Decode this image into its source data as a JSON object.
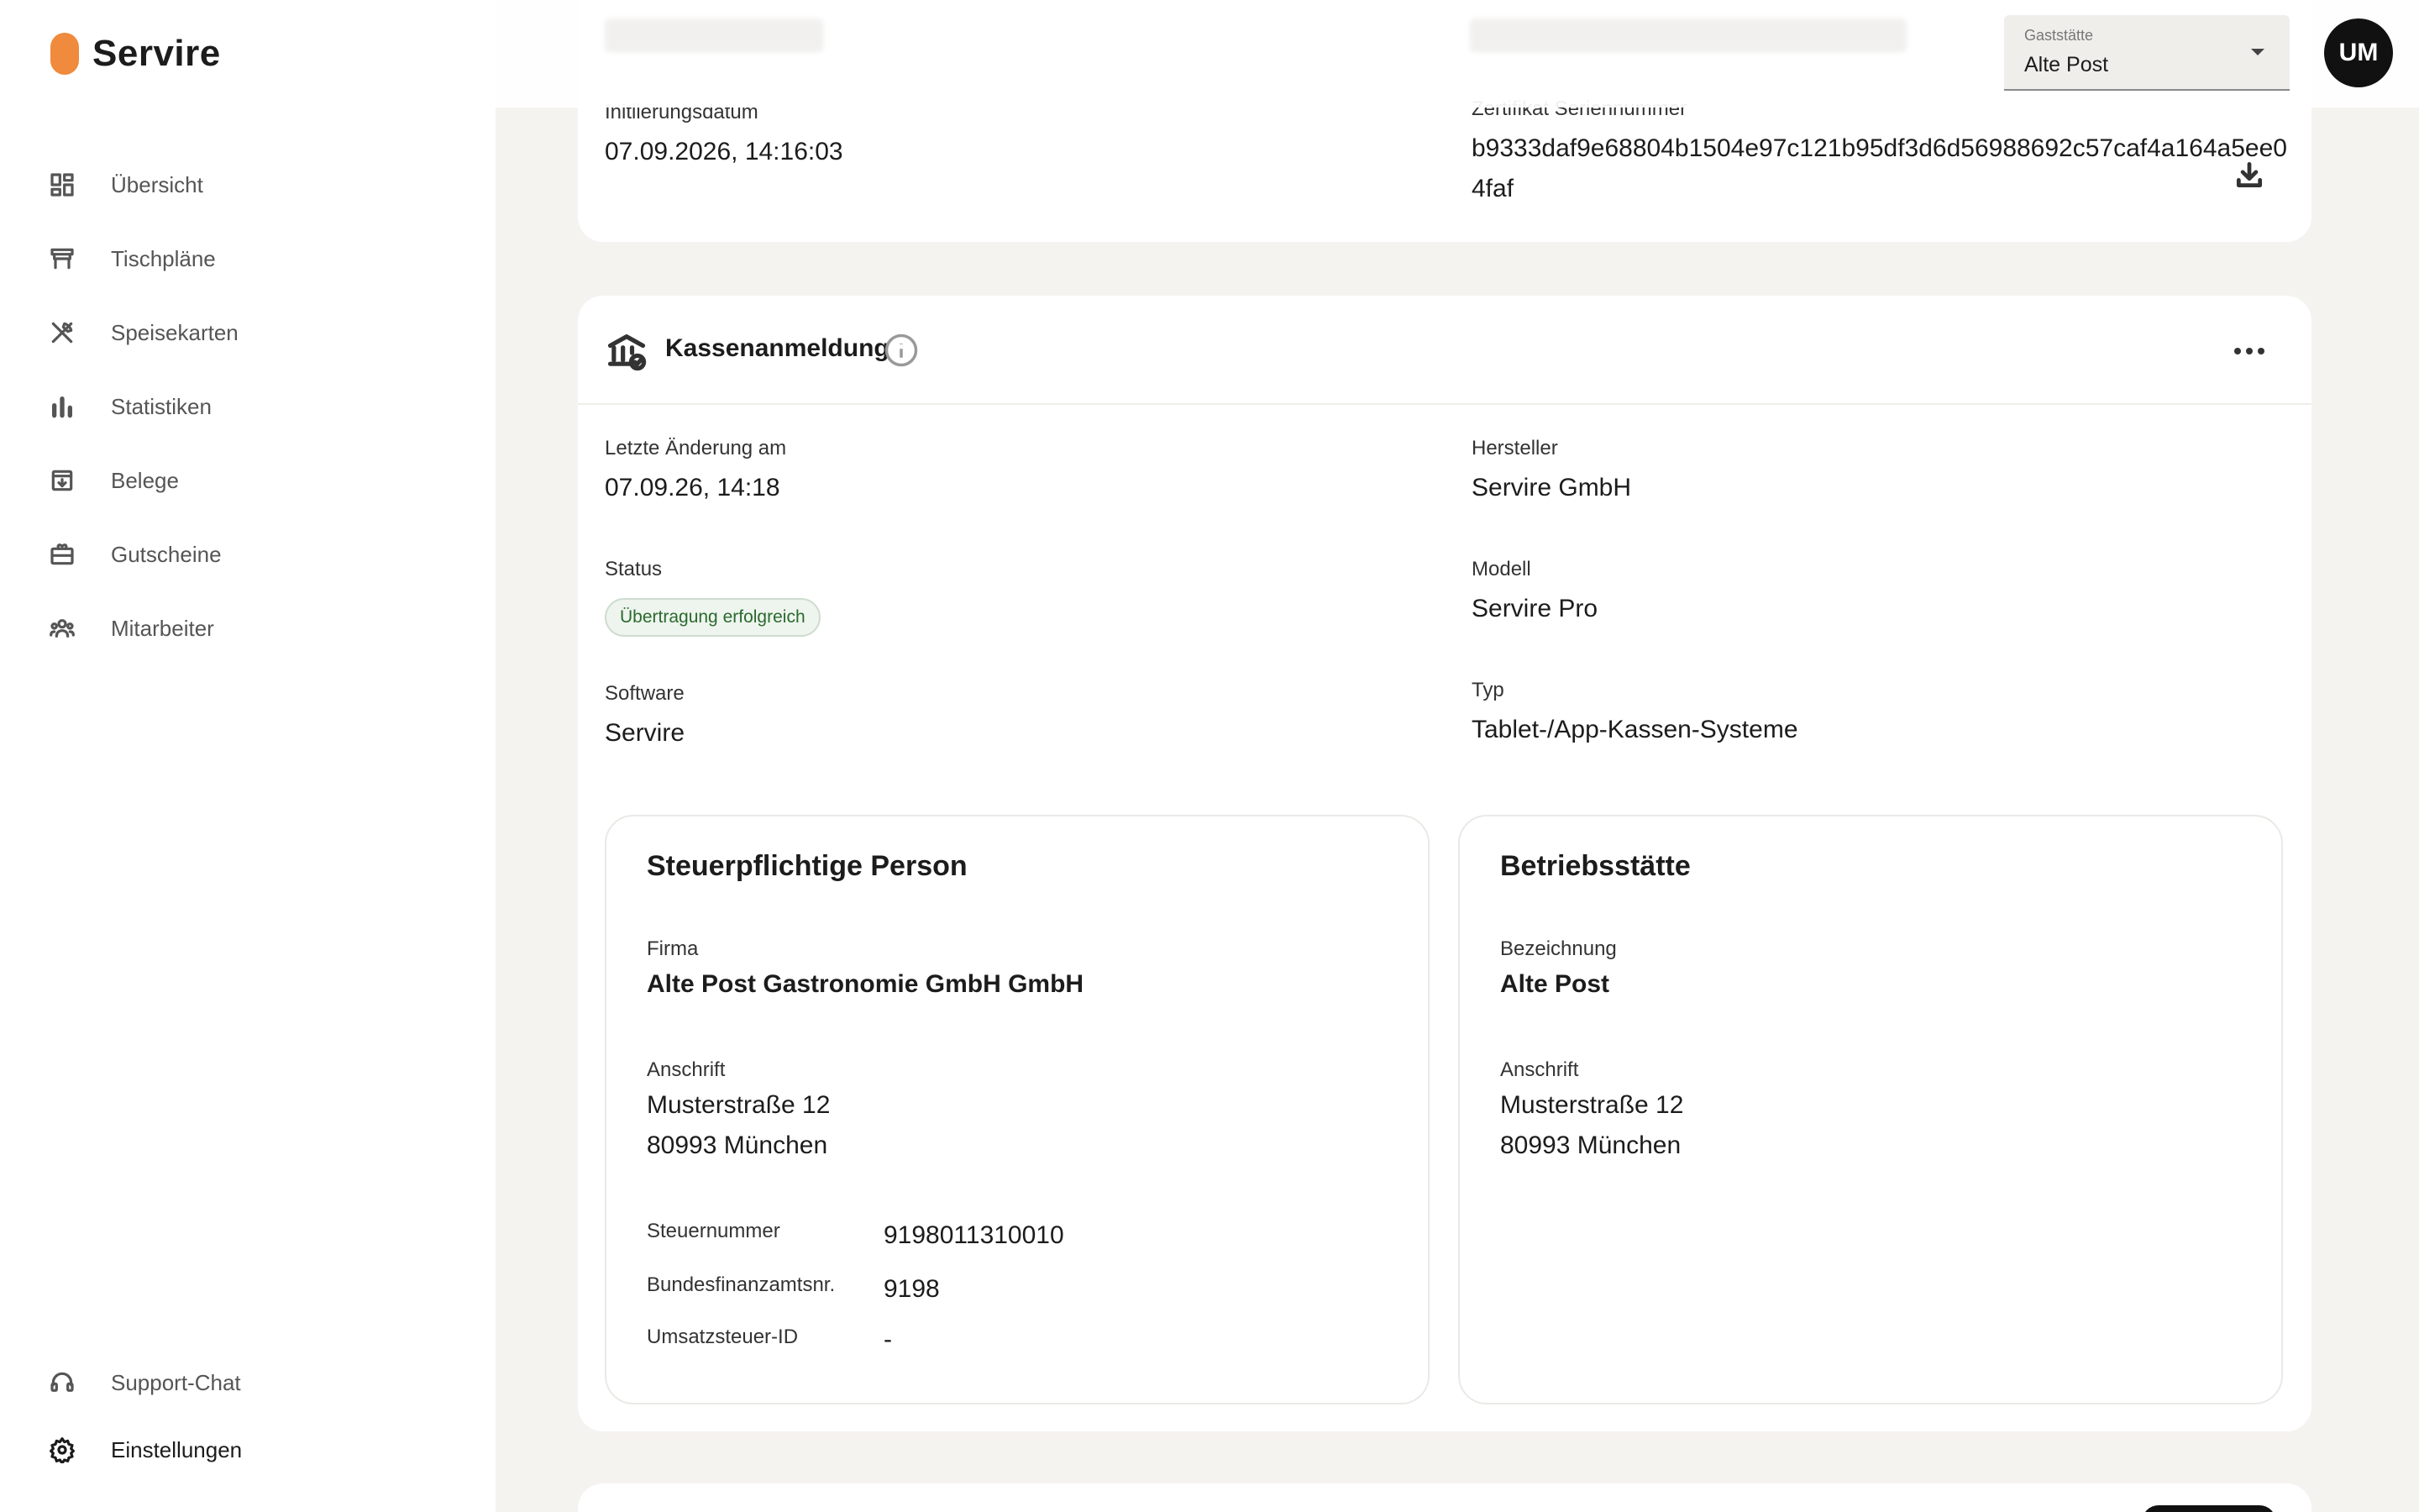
{
  "brand": {
    "name": "Servire",
    "color": "#f08a3c"
  },
  "nav": {
    "items": [
      {
        "label": "Übersicht",
        "icon": "dashboard-icon"
      },
      {
        "label": "Tischpläne",
        "icon": "table-icon"
      },
      {
        "label": "Speisekarten",
        "icon": "cutlery-icon"
      },
      {
        "label": "Statistiken",
        "icon": "bar-chart-icon"
      },
      {
        "label": "Belege",
        "icon": "receipt-archive-icon"
      },
      {
        "label": "Gutscheine",
        "icon": "gift-card-icon"
      },
      {
        "label": "Mitarbeiter",
        "icon": "people-icon"
      }
    ],
    "bottom": [
      {
        "label": "Support-Chat",
        "icon": "headset-icon"
      },
      {
        "label": "Einstellungen",
        "icon": "gear-icon",
        "active": true
      }
    ]
  },
  "header": {
    "venue_caption": "Gaststätte",
    "venue_value": "Alte Post",
    "avatar_initials": "UM"
  },
  "top_card": {
    "init_label": "Initiierungsdatum",
    "init_value": "07.09.2026, 14:16:03",
    "cert_label": "Zertifikat Seriennummer",
    "cert_value_line1": "b9333daf9e68804b1504e97c121b95df3d6d56988692c57caf4a164a5ee0",
    "cert_value_line2": "4faf"
  },
  "kasse": {
    "title": "Kassenanmeldung",
    "last_change_label": "Letzte Änderung am",
    "last_change_value": "07.09.26, 14:18",
    "status_label": "Status",
    "status_value": "Übertragung erfolgreich",
    "software_label": "Software",
    "software_value": "Servire",
    "hersteller_label": "Hersteller",
    "hersteller_value": "Servire GmbH",
    "modell_label": "Modell",
    "modell_value": "Servire Pro",
    "typ_label": "Typ",
    "typ_value": "Tablet-/App-Kassen-Systeme"
  },
  "steuer": {
    "title": "Steuerpflichtige Person",
    "firma_label": "Firma",
    "firma_value": "Alte Post Gastronomie GmbH GmbH",
    "anschrift_label": "Anschrift",
    "street": "Musterstraße 12",
    "city": "80993 München",
    "stnr_label": "Steuernummer",
    "stnr_value": "9198011310010",
    "bfa_label": "Bundesfinanzamtsnr.",
    "bfa_value": "9198",
    "ust_label": "Umsatzsteuer-ID",
    "ust_value": "-"
  },
  "betrieb": {
    "title": "Betriebsstätte",
    "bez_label": "Bezeichnung",
    "bez_value": "Alte Post",
    "anschrift_label": "Anschrift",
    "street": "Musterstraße 12",
    "city": "80993 München"
  }
}
